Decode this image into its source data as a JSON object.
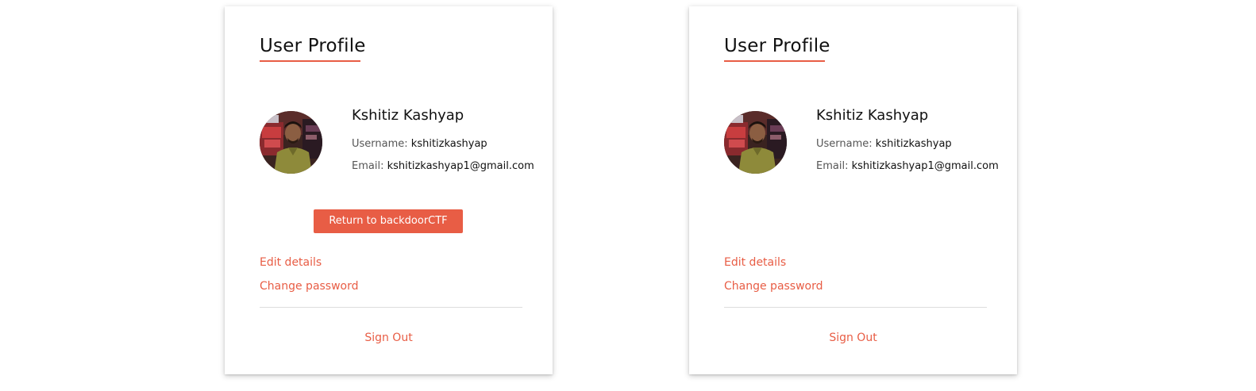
{
  "cards": [
    {
      "title": "User Profile",
      "name": "Kshitiz Kashyap",
      "username_label": "Username:",
      "username_value": "kshitizkashyap",
      "email_label": "Email:",
      "email_value": "kshitizkashyap1@gmail.com",
      "return_button_label": "Return to backdoorCTF",
      "edit_details_label": "Edit details",
      "change_password_label": "Change password",
      "sign_out_label": "Sign Out"
    },
    {
      "title": "User Profile",
      "name": "Kshitiz Kashyap",
      "username_label": "Username:",
      "username_value": "kshitizkashyap",
      "email_label": "Email:",
      "email_value": "kshitizkashyap1@gmail.com",
      "edit_details_label": "Edit details",
      "change_password_label": "Change password",
      "sign_out_label": "Sign Out"
    }
  ],
  "colors": {
    "accent": "#e85d45",
    "text": "#111111",
    "muted": "#555555",
    "divider": "#dddddd"
  },
  "icons": {
    "avatar": "profile-photo"
  }
}
